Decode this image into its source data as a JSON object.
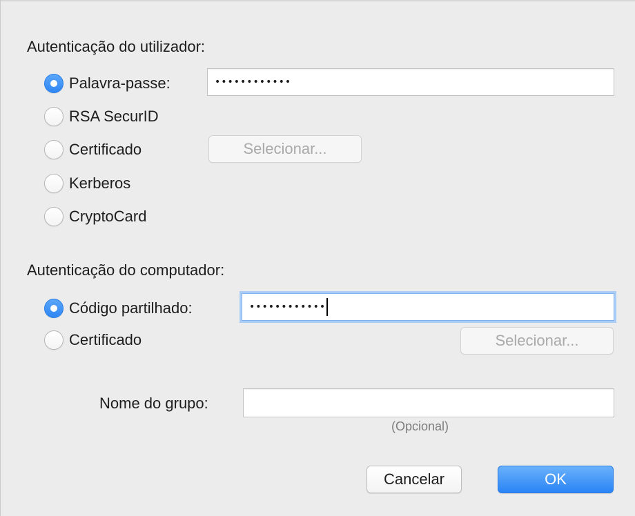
{
  "user_auth": {
    "title": "Autenticação do utilizador:",
    "options": [
      {
        "label": "Palavra-passe:",
        "checked": true,
        "icon": "radio-button-icon"
      },
      {
        "label": "RSA SecurID",
        "checked": false,
        "icon": "radio-button-icon"
      },
      {
        "label": "Certificado",
        "checked": false,
        "icon": "radio-button-icon"
      },
      {
        "label": "Kerberos",
        "checked": false,
        "icon": "radio-button-icon"
      },
      {
        "label": "CryptoCard",
        "checked": false,
        "icon": "radio-button-icon"
      }
    ],
    "password_value": "••••••••••••",
    "select_button_label": "Selecionar...",
    "select_button_enabled": false
  },
  "machine_auth": {
    "title": "Autenticação do computador:",
    "options": [
      {
        "label": "Código partilhado:",
        "checked": true,
        "icon": "radio-button-icon"
      },
      {
        "label": "Certificado",
        "checked": false,
        "icon": "radio-button-icon"
      }
    ],
    "shared_secret_value": "••••••••••••",
    "shared_secret_focused": true,
    "select_button_label": "Selecionar...",
    "select_button_enabled": false
  },
  "group": {
    "label": "Nome do grupo:",
    "value": "",
    "hint": "(Opcional)"
  },
  "actions": {
    "cancel_label": "Cancelar",
    "ok_label": "OK"
  },
  "colors": {
    "accent": "#2f87f3",
    "window_bg": "#ececec",
    "disabled_text": "#a9a9a9"
  }
}
